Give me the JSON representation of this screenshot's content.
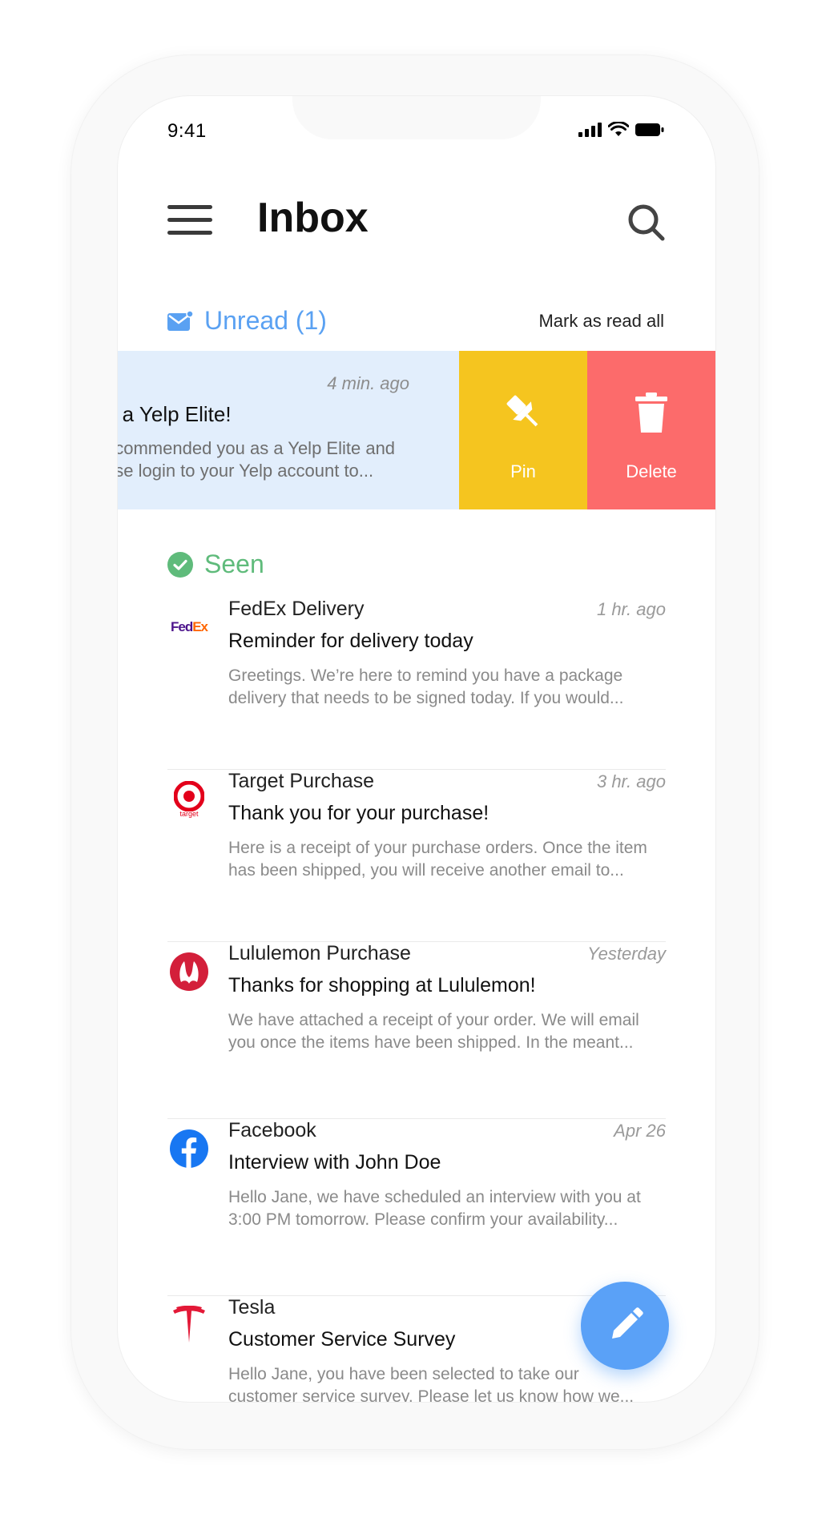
{
  "status_bar": {
    "time": "9:41"
  },
  "header": {
    "title": "Inbox"
  },
  "unread": {
    "label": "Unread (1)",
    "mark_all": "Mark as read all",
    "item": {
      "time": "4 min. ago",
      "subject": "e a Yelp Elite!",
      "preview": "ecommended you as a Yelp Elite and\nase login to your Yelp account to...",
      "pin_label": "Pin",
      "delete_label": "Delete"
    }
  },
  "seen": {
    "label": "Seen",
    "mails": [
      {
        "sender": "FedEx Delivery",
        "time": "1 hr. ago",
        "subject": "Reminder for delivery today",
        "preview": "Greetings. We’re here to remind you have a package\ndelivery that needs to be signed today. If you would...",
        "logo": "fedex-logo-icon"
      },
      {
        "sender": "Target Purchase",
        "time": "3 hr. ago",
        "subject": "Thank you for your purchase!",
        "preview": "Here is a receipt of your purchase orders. Once the item\nhas been shipped, you will receive another email to...",
        "logo": "target-logo-icon"
      },
      {
        "sender": "Lululemon Purchase",
        "time": "Yesterday",
        "subject": "Thanks for shopping at Lululemon!",
        "preview": "We have attached a receipt of your order. We will email\nyou once the items have been shipped. In the meant...",
        "logo": "lululemon-logo-icon"
      },
      {
        "sender": "Facebook",
        "time": "Apr 26",
        "subject": "Interview with John Doe",
        "preview": "Hello Jane, we have scheduled an interview with you at\n3:00 PM tomorrow. Please confirm your availability...",
        "logo": "facebook-logo-icon"
      },
      {
        "sender": "Tesla",
        "time": "",
        "subject": "Customer Service Survey",
        "preview": "Hello Jane, you have been selected to take our\ncustomer service survey. Please let us know how we...",
        "logo": "tesla-logo-icon"
      }
    ]
  },
  "logo_text": {
    "fedex_fed": "Fed",
    "fedex_ex": "Ex",
    "target_word": "target"
  },
  "colors": {
    "accent": "#5aa1f2",
    "seen": "#5fbb7b",
    "pin": "#f5c51f",
    "delete": "#fc6b6b",
    "unread_bg": "#e2eefc"
  }
}
